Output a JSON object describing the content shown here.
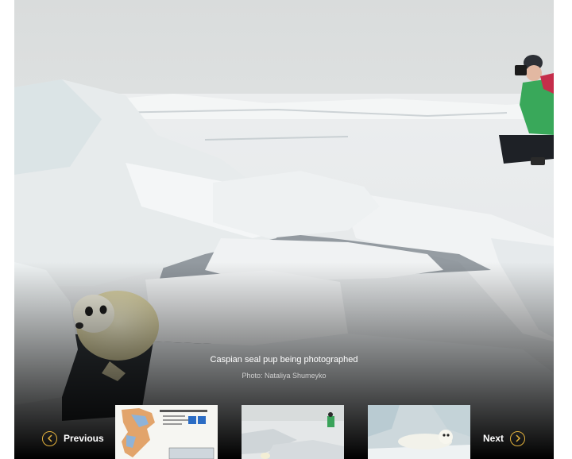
{
  "slide": {
    "caption": "Caspian seal pup being photographed",
    "credit": "Photo: Nataliya Shumeyko"
  },
  "nav": {
    "previous_label": "Previous",
    "next_label": "Next",
    "previous_icon": "chevron-left-icon",
    "next_icon": "chevron-right-icon",
    "accent_color": "#e2b13c"
  },
  "thumbnails": [
    {
      "name": "thumbnail-map",
      "icon": "map-image"
    },
    {
      "name": "thumbnail-photographer",
      "icon": "photo-image"
    },
    {
      "name": "thumbnail-seal-pup",
      "icon": "photo-image"
    }
  ]
}
